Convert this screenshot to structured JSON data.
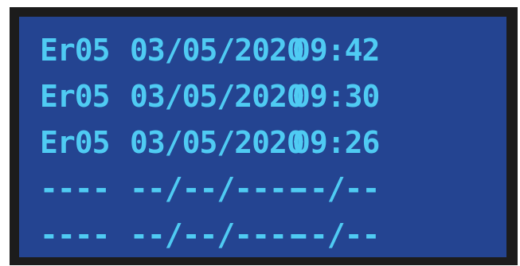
{
  "log": {
    "entries": [
      {
        "code": "Er05",
        "date": "03/05/2020",
        "time": "09:42"
      },
      {
        "code": "Er05",
        "date": "03/05/2020",
        "time": "09:30"
      },
      {
        "code": "Er05",
        "date": "03/05/2020",
        "time": "09:26"
      },
      {
        "code": "----",
        "date": "--/--/----",
        "time": "--/--"
      },
      {
        "code": "----",
        "date": "--/--/----",
        "time": "--/--"
      }
    ]
  },
  "colors": {
    "screen_background": "#244491",
    "text": "#4fcbf3",
    "bezel": "#1c1c1c"
  }
}
